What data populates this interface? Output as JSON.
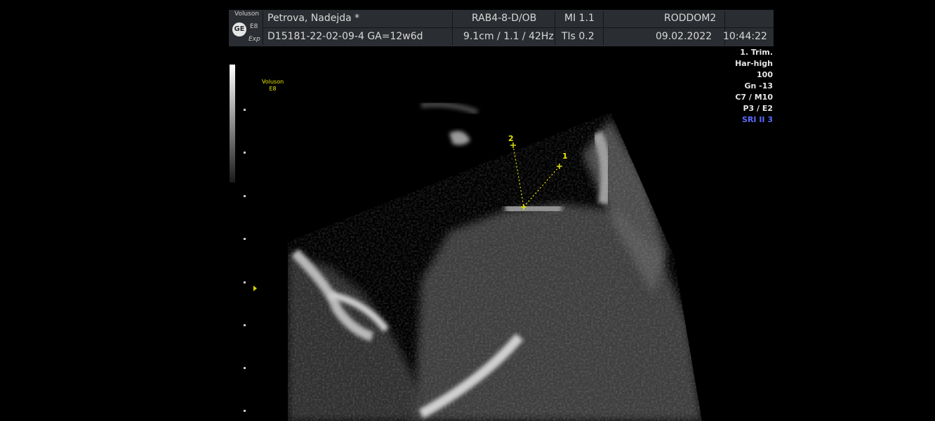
{
  "header": {
    "logo": {
      "brand_top": "Voluson",
      "model": "E8",
      "sub": "Exp",
      "icon": "ge-logo-icon"
    },
    "patient_name": "Petrova, Nadejda  *",
    "patient_id_ga": "D15181-22-02-09-4  GA=12w6d",
    "probe_app": "RAB4-8-D/OB",
    "depth_info": "9.1cm / 1.1 / 42Hz",
    "mi": "MI  1.1",
    "tis": "TIs  0.2",
    "institution": "RODDOM2",
    "date": "09.02.2022",
    "time": "10:44:22"
  },
  "settings": {
    "lines": [
      "1. Trim.",
      "Har-high",
      "100",
      "Gn -13",
      "C7 / M10",
      "P3 / E2"
    ],
    "sri": "SRI II 3",
    "sri_color": "#5c6cff"
  },
  "overlay": {
    "voluson_label": "Voluson",
    "e8_label": "E8"
  },
  "calipers": [
    {
      "label": "1"
    },
    {
      "label": "2"
    }
  ]
}
